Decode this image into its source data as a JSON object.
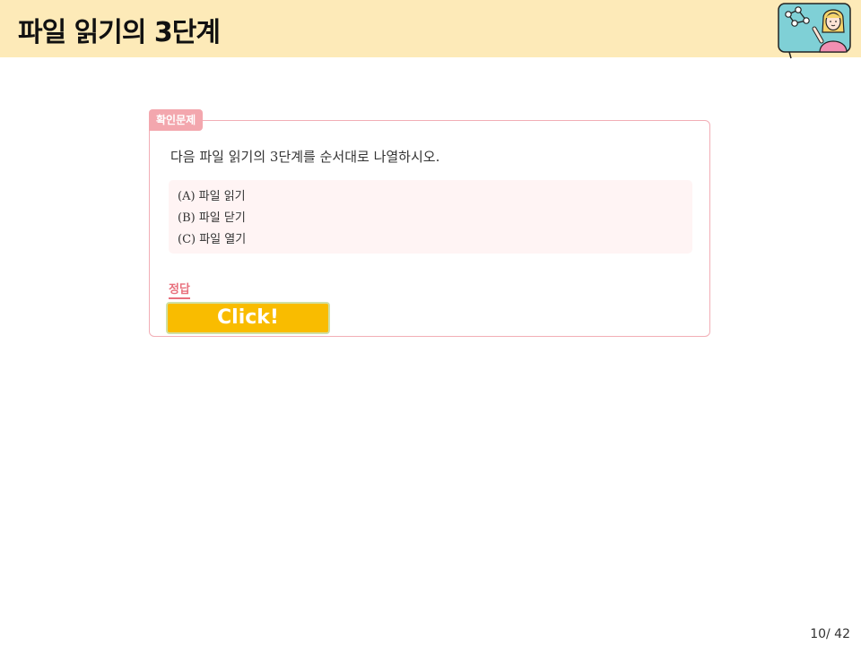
{
  "header": {
    "title": "파일 읽기의 3단계",
    "mascot_icon": "teacher-with-network-board-icon"
  },
  "quiz": {
    "badge": "확인문제",
    "question": "다음 파일 읽기의 3단계를 순서대로 나열하시오.",
    "options": [
      "(A) 파일 읽기",
      "(B) 파일 닫기",
      "(C) 파일 열기"
    ],
    "answer_label": "정답",
    "click_label": "Click!"
  },
  "footer": {
    "page_number": "10/ 42"
  },
  "colors": {
    "header_bg": "#fdeab8",
    "accent_pink": "#f3a7ae",
    "button_yellow": "#f9bc00"
  }
}
